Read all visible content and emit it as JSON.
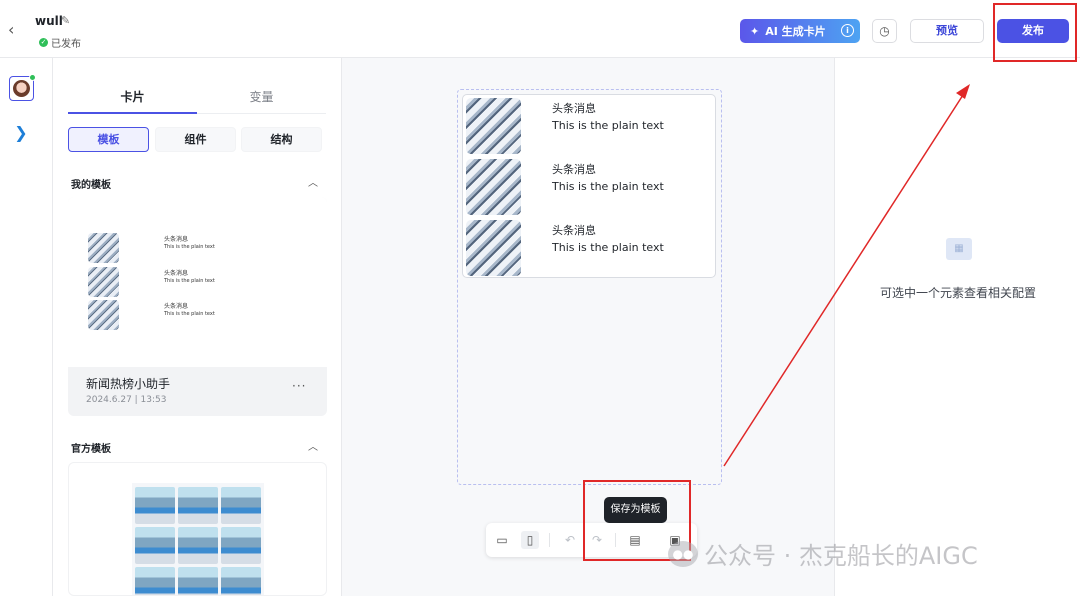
{
  "header": {
    "app_name": "wull",
    "status": "已发布",
    "ai_button": "AI 生成卡片",
    "preview": "预览",
    "publish": "发布"
  },
  "panel": {
    "tabs": [
      {
        "label": "卡片",
        "active": true
      },
      {
        "label": "变量",
        "active": false
      }
    ],
    "segments": [
      {
        "label": "模板",
        "active": true
      },
      {
        "label": "组件",
        "active": false
      },
      {
        "label": "结构",
        "active": false
      }
    ],
    "my_templates": {
      "title": "我的模板",
      "card": {
        "rows": [
          {
            "headline": "头条消息",
            "text": "This is the plain text"
          },
          {
            "headline": "头条消息",
            "text": "This is the plain text"
          },
          {
            "headline": "头条消息",
            "text": "This is the plain text"
          }
        ],
        "name": "新闻热榜小助手",
        "date": "2024.6.27 | 13:53",
        "more": "···"
      }
    },
    "official_templates": {
      "title": "官方模板"
    }
  },
  "canvas": {
    "rows": [
      {
        "headline": "头条消息",
        "text": "This is the plain text"
      },
      {
        "headline": "头条消息",
        "text": "This is the plain text"
      },
      {
        "headline": "头条消息",
        "text": "This is the plain text"
      }
    ],
    "tooltip": "保存为模板"
  },
  "right_panel": {
    "empty_text": "可选中一个元素查看相关配置"
  },
  "watermark": {
    "text": "公众号 · 杰克船长的AIGC"
  },
  "colors": {
    "accent": "#4b52e4",
    "annotation_red": "#e02828",
    "status_green": "#2fbf59"
  },
  "icons": [
    "back-icon",
    "edit-icon",
    "check-circle-icon",
    "ai-sparkle-icon",
    "info-icon",
    "history-icon",
    "chevron-up-icon",
    "desktop-icon",
    "mobile-icon",
    "undo-icon",
    "redo-icon",
    "save-template-icon",
    "export-icon",
    "empty-state-icon",
    "wechat-icon"
  ]
}
